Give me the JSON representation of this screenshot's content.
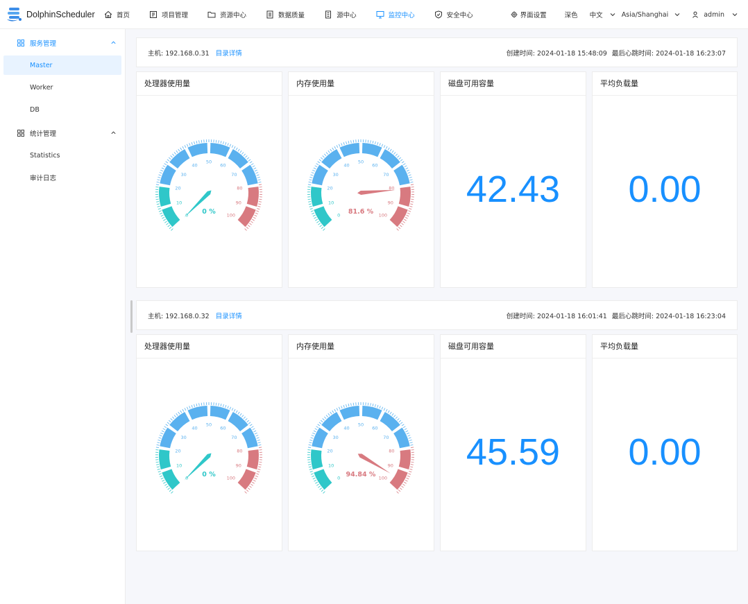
{
  "app": {
    "name": "DolphinScheduler",
    "colors": {
      "accent": "#1890ff",
      "gauge_low": "#2fc7c9",
      "gauge_mid": "#5ab1ef",
      "gauge_high": "#d87a80"
    }
  },
  "nav": {
    "items": [
      {
        "label": "首页",
        "icon": "home-icon"
      },
      {
        "label": "项目管理",
        "icon": "project-icon"
      },
      {
        "label": "资源中心",
        "icon": "folder-icon"
      },
      {
        "label": "数据质量",
        "icon": "document-icon"
      },
      {
        "label": "源中心",
        "icon": "datasource-icon"
      },
      {
        "label": "监控中心",
        "icon": "monitor-icon",
        "active": true
      },
      {
        "label": "安全中心",
        "icon": "shield-icon"
      }
    ]
  },
  "header_tools": {
    "ui_settings": "界面设置",
    "theme": "深色",
    "language": "中文",
    "timezone": "Asia/Shanghai",
    "user": "admin"
  },
  "sidebar": {
    "groups": [
      {
        "label": "服务管理",
        "icon": "grid-icon",
        "active": true,
        "items": [
          {
            "label": "Master",
            "active": true
          },
          {
            "label": "Worker"
          },
          {
            "label": "DB"
          }
        ]
      },
      {
        "label": "统计管理",
        "icon": "grid-icon",
        "items": [
          {
            "label": "Statistics"
          },
          {
            "label": "审计日志"
          }
        ]
      }
    ]
  },
  "hosts": [
    {
      "host_label": "主机: 192.168.0.31",
      "detail_link": "目录详情",
      "created": "创建时间: 2024-01-18 15:48:09",
      "heartbeat": "最后心跳时间: 2024-01-18 16:23:07",
      "cpu": {
        "title": "处理器使用量",
        "value": 0,
        "label": "0 %"
      },
      "memory": {
        "title": "内存使用量",
        "value": 81.6,
        "label": "81.6 %"
      },
      "disk": {
        "title": "磁盘可用容量",
        "value": "42.43"
      },
      "load": {
        "title": "平均负载量",
        "value": "0.00"
      }
    },
    {
      "host_label": "主机: 192.168.0.32",
      "detail_link": "目录详情",
      "created": "创建时间: 2024-01-18 16:01:41",
      "heartbeat": "最后心跳时间: 2024-01-18 16:23:04",
      "cpu": {
        "title": "处理器使用量",
        "value": 0,
        "label": "0 %"
      },
      "memory": {
        "title": "内存使用量",
        "value": 94.84,
        "label": "94.84 %"
      },
      "disk": {
        "title": "磁盘可用容量",
        "value": "45.59"
      },
      "load": {
        "title": "平均负载量",
        "value": "0.00"
      }
    }
  ],
  "gauge_ticks": [
    "0",
    "10",
    "20",
    "30",
    "40",
    "50",
    "60",
    "70",
    "80",
    "90",
    "100"
  ]
}
